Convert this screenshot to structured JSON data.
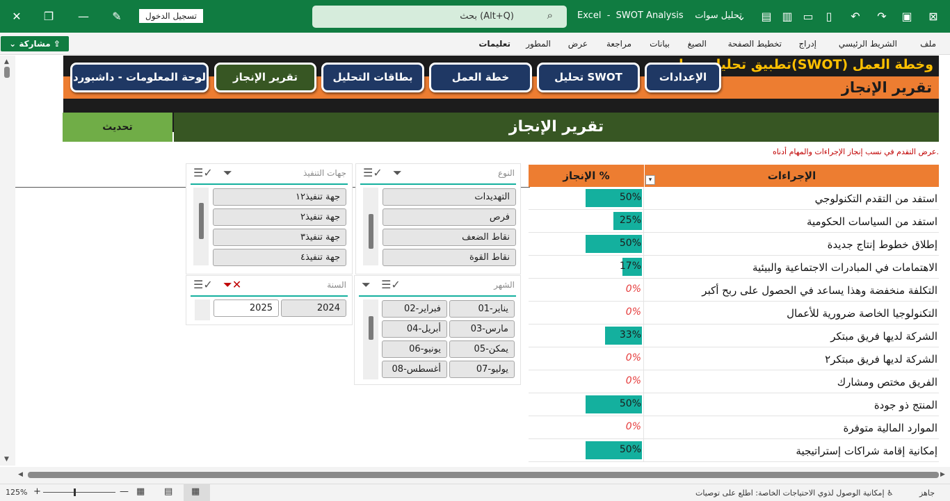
{
  "titlebar": {
    "app": "Excel",
    "file": "SWOT Analysis",
    "doc": "تحليل سوات",
    "search_label": "بحث (Alt+Q)",
    "signin": "تسجيل الدخول"
  },
  "ribbon": {
    "share": "مشاركة",
    "tabs": [
      "ملف",
      "الشريط الرئيسي",
      "إدراج",
      "تخطيط الصفحة",
      "الصيغ",
      "بيانات",
      "مراجعة",
      "عرض",
      "المطور",
      "تعليمات"
    ]
  },
  "header": {
    "app_title": "تطبيق تحليل سوات(SWOT) وخطة العمل",
    "subtitle": "تقرير الإنجاز"
  },
  "nav": {
    "buttons": [
      "الإعدادات",
      "تحليل SWOT",
      "خطة العمل",
      "بطاقات التحليل",
      "تقرير الإنجاز",
      "لوحة المعلومات - داشبورد"
    ]
  },
  "banner": {
    "title": "تقرير الإنجاز",
    "refresh": "تحديث"
  },
  "note": "عرض التقدم في نسب إنجاز  الإجراءات والمهام أدناه.",
  "table": {
    "col_actions": "الإجراءات",
    "col_pct": "الإنجاز %",
    "rows": [
      {
        "action": "استفد من التقدم التكنولوجي",
        "pct": "50%",
        "value": 0.5
      },
      {
        "action": "استفد من السياسات الحكومية",
        "pct": "25%",
        "value": 0.25
      },
      {
        "action": "إطلاق خطوط إنتاج جديدة",
        "pct": "50%",
        "value": 0.5
      },
      {
        "action": "الاهتمامات في المبادرات الاجتماعية والبيئية",
        "pct": "17%",
        "value": 0.17
      },
      {
        "action": "التكلفة منخفضة وهذا يساعد في الحصول على ربح أكبر",
        "pct": "0%",
        "value": 0
      },
      {
        "action": "التكنولوجيا الخاصة ضرورية للأعمال",
        "pct": "0%",
        "value": 0
      },
      {
        "action": "الشركة لديها فريق مبتكر",
        "pct": "33%",
        "value": 0.33
      },
      {
        "action": "الشركة لديها فريق مبتكر٢",
        "pct": "0%",
        "value": 0
      },
      {
        "action": "الفريق مختص ومشارك",
        "pct": "0%",
        "value": 0
      },
      {
        "action": "المنتج ذو جودة",
        "pct": "50%",
        "value": 0.5
      },
      {
        "action": "الموارد المالية متوفرة",
        "pct": "0%",
        "value": 0
      },
      {
        "action": "إمكانية إقامة شراكات إستراتيجية",
        "pct": "50%",
        "value": 0.5
      }
    ]
  },
  "slicers": {
    "type": {
      "title": "النوع",
      "items": [
        "التهديدات",
        "فرص",
        "نقاط الضعف",
        "نقاط القوة"
      ]
    },
    "entities": {
      "title": "جهات التنفيذ",
      "items": [
        "جهة تنفيذ١٢",
        "جهة تنفيذ٢",
        "جهة تنفيذ٣",
        "جهة تنفيذ٤"
      ]
    },
    "month": {
      "title": "الشهر",
      "items": [
        "يناير-01",
        "فبراير-02",
        "مارس-03",
        "أبريل-04",
        "يمكن-05",
        "يونيو-06",
        "يوليو-07",
        "أغسطس-08"
      ]
    },
    "year": {
      "title": "السنة",
      "items": [
        "2024",
        "2025"
      ]
    }
  },
  "status": {
    "ready": "جاهز",
    "accessibility": "إمكانية الوصول لذوي الاحتياجات الخاصة: اطلع على توصيات",
    "zoom": "125%"
  },
  "colors": {
    "excel_green": "#107c41",
    "accent_orange": "#ed7d31",
    "dark_green": "#375623",
    "bar_teal": "#14b09e",
    "navy": "#1f3864"
  }
}
